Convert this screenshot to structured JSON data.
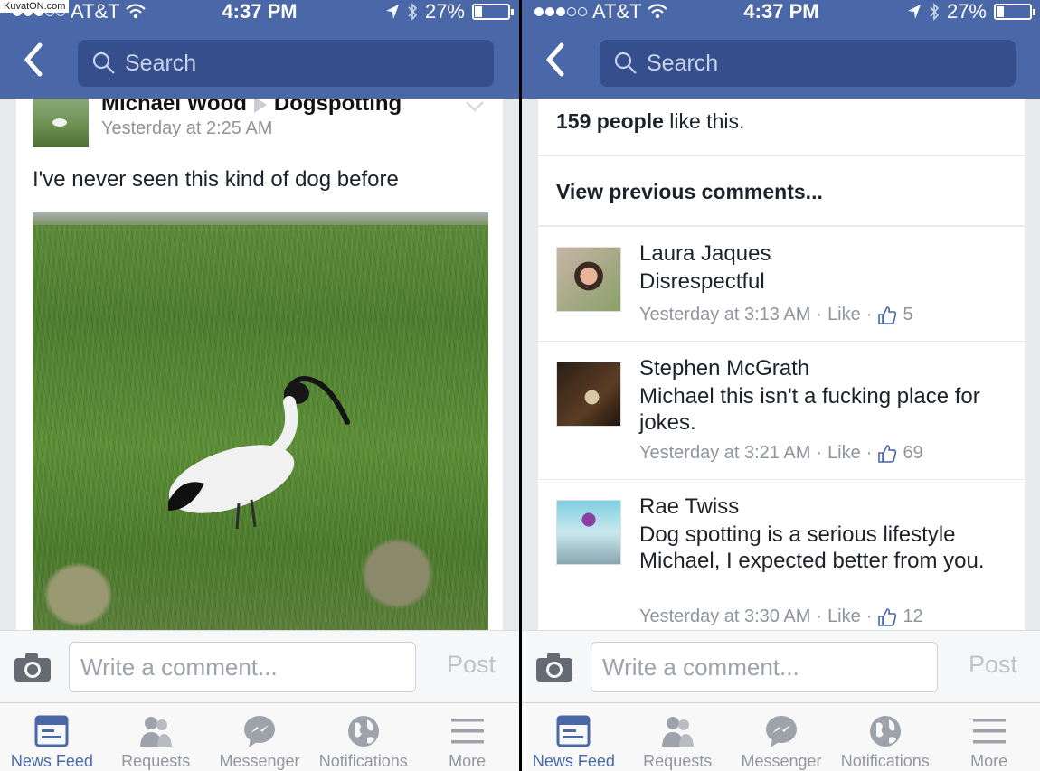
{
  "watermark": "KuvatON.com",
  "left": {
    "status": {
      "carrier": "AT&T",
      "time": "4:37 PM",
      "battery": "27%",
      "battery_level": 0.27
    },
    "search_placeholder": "Search",
    "post": {
      "author": "Michael Wood",
      "group": "Dogspotting",
      "time": "Yesterday at 2:25 AM",
      "text": "I've never seen this kind of dog before"
    },
    "composer": {
      "placeholder": "Write a comment...",
      "post_label": "Post"
    },
    "tabs": [
      {
        "label": "News Feed",
        "icon": "news-feed-icon"
      },
      {
        "label": "Requests",
        "icon": "requests-icon"
      },
      {
        "label": "Messenger",
        "icon": "messenger-icon"
      },
      {
        "label": "Notifications",
        "icon": "globe-icon"
      },
      {
        "label": "More",
        "icon": "menu-icon"
      }
    ]
  },
  "right": {
    "status": {
      "carrier": "AT&T",
      "time": "4:37 PM",
      "battery": "27%",
      "battery_level": 0.27
    },
    "search_placeholder": "Search",
    "likes_count": "159 people",
    "likes_suffix": " like this.",
    "view_previous": "View previous comments...",
    "comments": [
      {
        "name": "Laura Jaques",
        "text": "Disrespectful",
        "time": "Yesterday at 3:13 AM",
        "like": "Like",
        "likes": "5"
      },
      {
        "name": "Stephen McGrath",
        "text": "Michael this isn't a fucking place for jokes.",
        "time": "Yesterday at 3:21 AM",
        "like": "Like",
        "likes": "69"
      },
      {
        "name": "Rae Twiss",
        "text": "Dog spotting is a serious lifestyle Michael, I expected better from you.",
        "time": "Yesterday at 3:30 AM",
        "like": "Like",
        "likes": "12"
      }
    ],
    "composer": {
      "placeholder": "Write a comment...",
      "post_label": "Post"
    },
    "tabs": [
      {
        "label": "News Feed",
        "icon": "news-feed-icon"
      },
      {
        "label": "Requests",
        "icon": "requests-icon"
      },
      {
        "label": "Messenger",
        "icon": "messenger-icon"
      },
      {
        "label": "Notifications",
        "icon": "globe-icon"
      },
      {
        "label": "More",
        "icon": "menu-icon"
      }
    ]
  },
  "colors": {
    "brand": "#4a67a8",
    "search_bg": "#354f8d",
    "muted": "#90949c"
  }
}
